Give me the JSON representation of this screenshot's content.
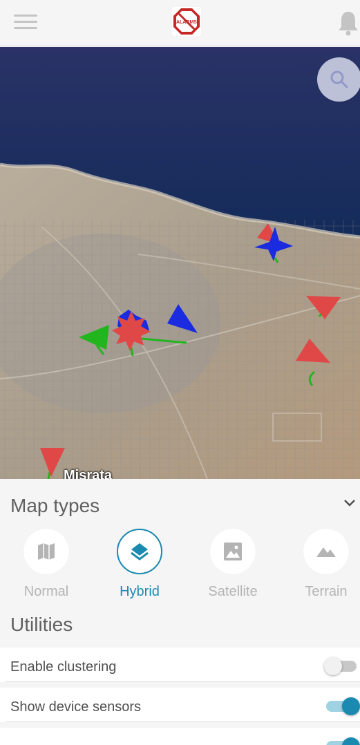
{
  "header": {
    "menu_icon": "hamburger-menu-icon",
    "logo_icon": "no-alarms-logo",
    "logo_text": "ALARMS",
    "notification_icon": "bell-icon"
  },
  "map": {
    "zoom_icon": "search-icon",
    "place_label": "Misrata",
    "marker_colors": {
      "red": "#e04848",
      "blue": "#1a2be0",
      "green": "#22b51e"
    }
  },
  "map_types": {
    "title": "Map types",
    "collapse_icon": "chevron-down-icon",
    "selected": "Hybrid",
    "items": [
      {
        "label": "Normal",
        "icon": "map-icon"
      },
      {
        "label": "Hybrid",
        "icon": "layers-icon"
      },
      {
        "label": "Satellite",
        "icon": "image-icon"
      },
      {
        "label": "Terrain",
        "icon": "mountains-icon"
      }
    ]
  },
  "utilities": {
    "title": "Utilities",
    "items": [
      {
        "label": "Enable clustering",
        "enabled": false
      },
      {
        "label": "Show device sensors",
        "enabled": true
      }
    ]
  },
  "colors": {
    "accent": "#1a8ab0",
    "inactive": "#b4b4b4"
  }
}
